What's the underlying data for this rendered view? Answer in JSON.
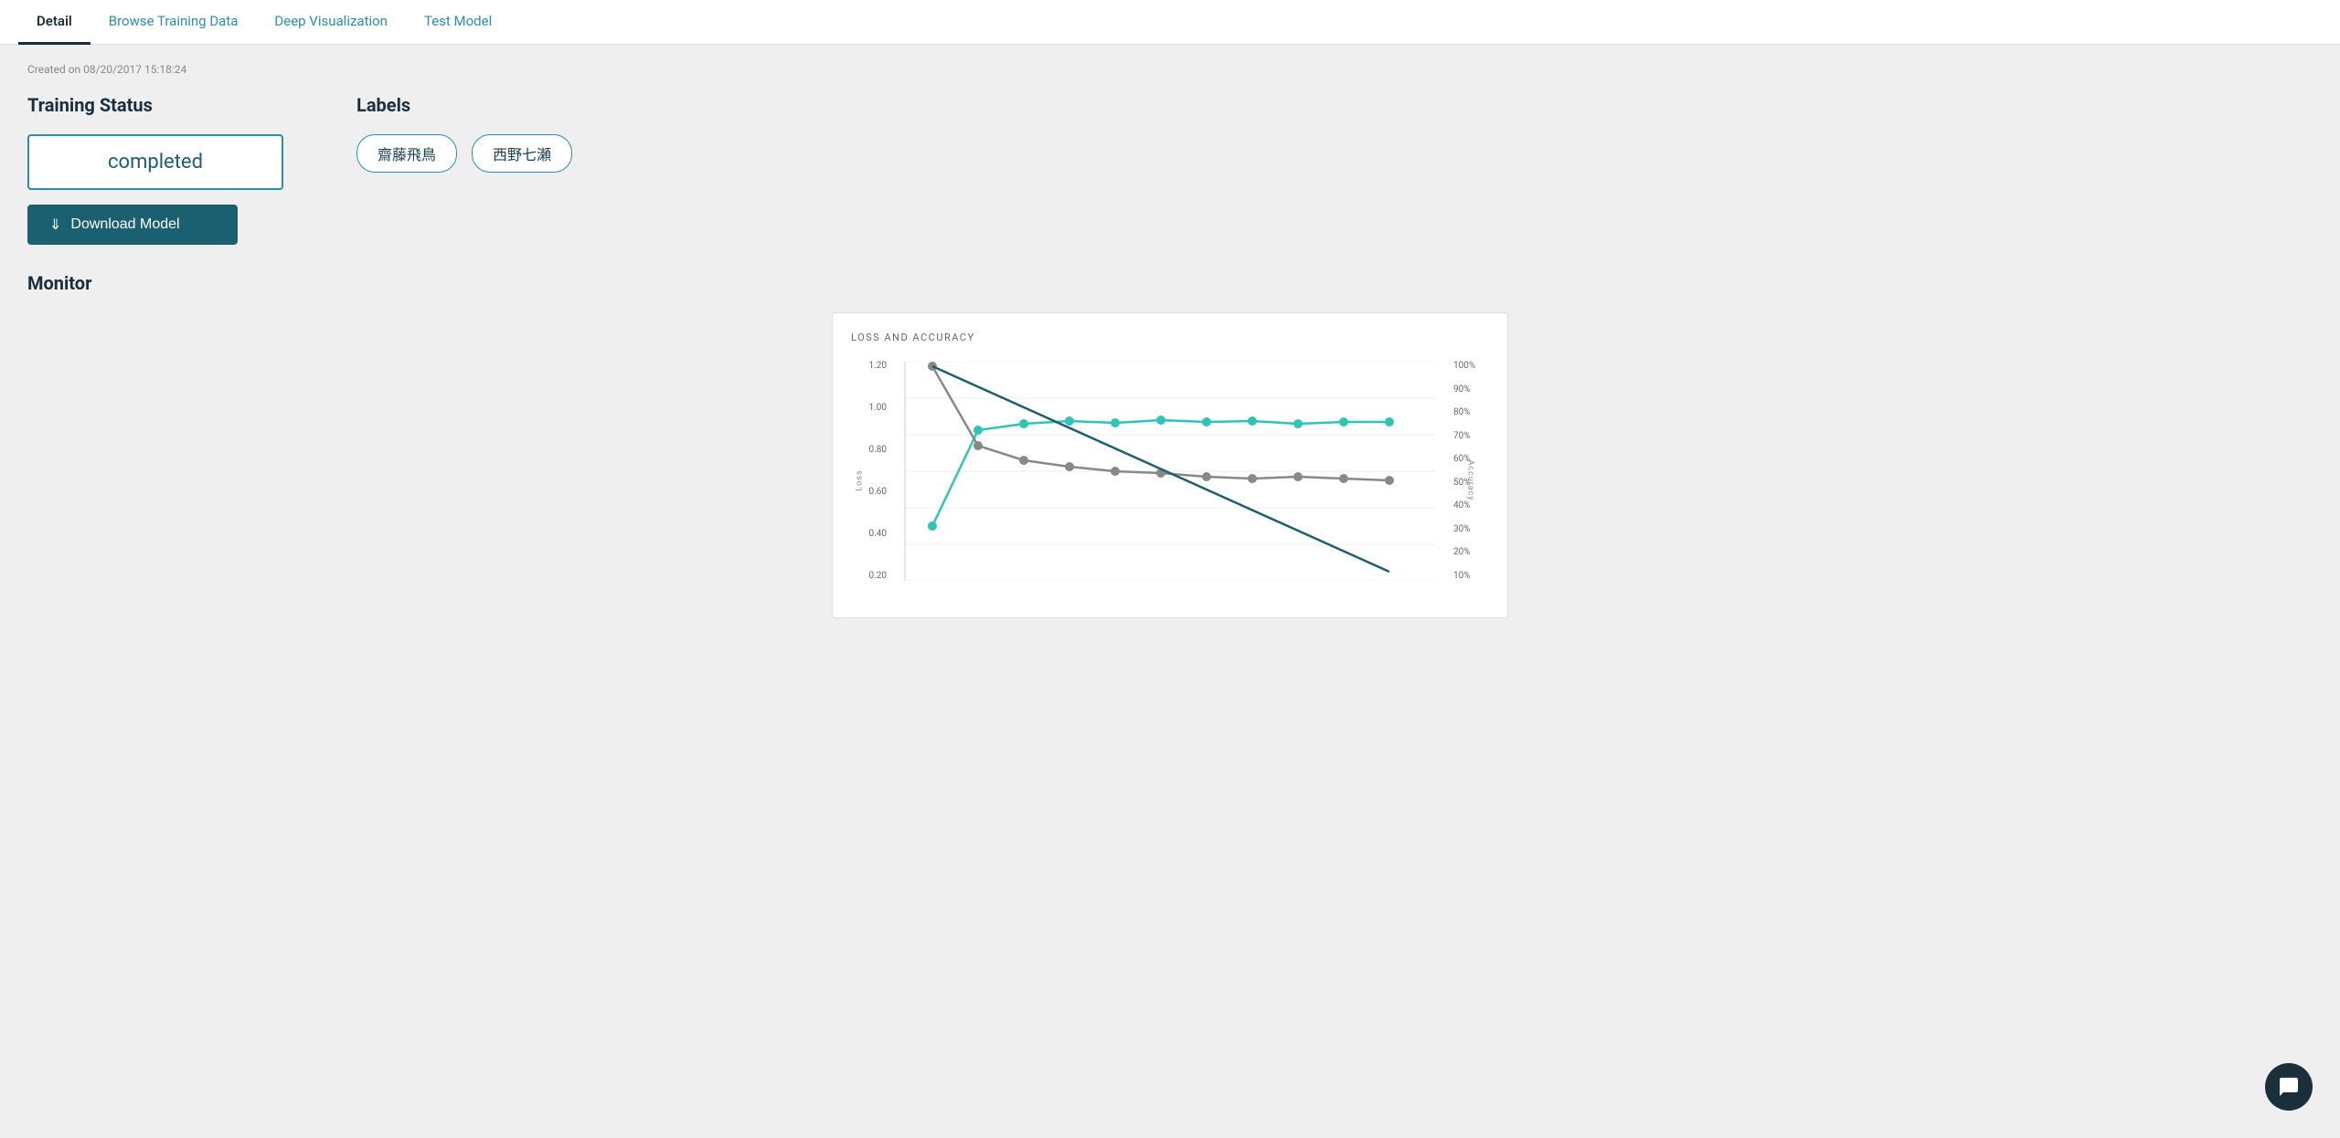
{
  "tabs": [
    {
      "label": "Detail",
      "active": true
    },
    {
      "label": "Browse Training Data",
      "active": false
    },
    {
      "label": "Deep Visualization",
      "active": false
    },
    {
      "label": "Test Model",
      "active": false
    }
  ],
  "created_label": "Created on 08/20/2017 15:18:24",
  "training_status": {
    "title": "Training Status",
    "status": "completed",
    "download_button": "Download Model"
  },
  "labels": {
    "title": "Labels",
    "items": [
      "齋藤飛鳥",
      "西野七瀬"
    ]
  },
  "monitor": {
    "title": "Monitor",
    "chart": {
      "title": "LOSS AND ACCURACY",
      "y_left_labels": [
        "1.20",
        "1.00",
        "0.80",
        "0.60",
        "0.40",
        "0.20"
      ],
      "y_right_labels": [
        "100%",
        "90%",
        "80%",
        "70%",
        "60%",
        "50%",
        "40%",
        "30%",
        "20%",
        "10%"
      ],
      "axis_left": "Loss",
      "axis_right": "Accuracy"
    }
  },
  "chat_icon": "chat-icon"
}
